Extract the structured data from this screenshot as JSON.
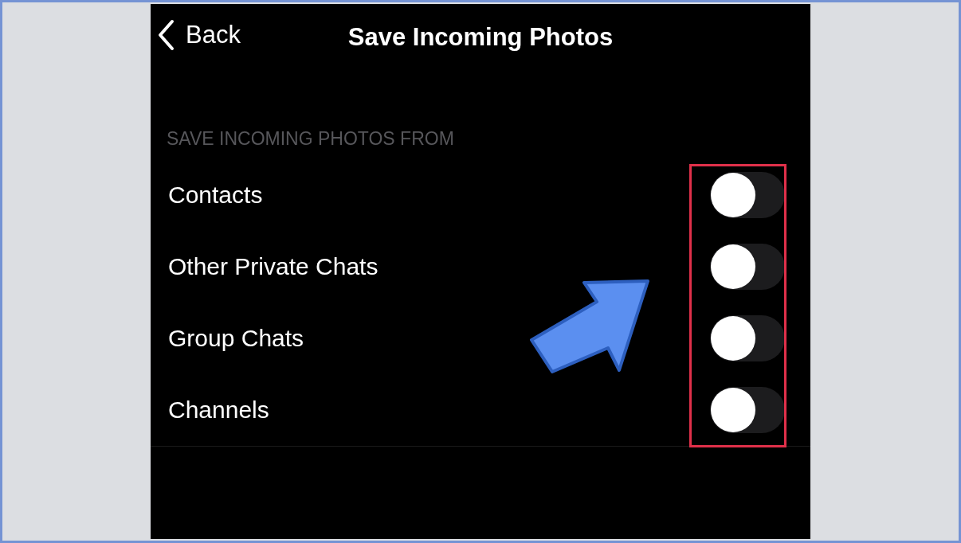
{
  "nav": {
    "back": "Back",
    "title": "Save Incoming Photos"
  },
  "section": {
    "header": "SAVE INCOMING PHOTOS FROM"
  },
  "rows": [
    {
      "label": "Contacts",
      "on": false
    },
    {
      "label": "Other Private Chats",
      "on": false
    },
    {
      "label": "Group Chats",
      "on": false
    },
    {
      "label": "Channels",
      "on": false
    }
  ]
}
